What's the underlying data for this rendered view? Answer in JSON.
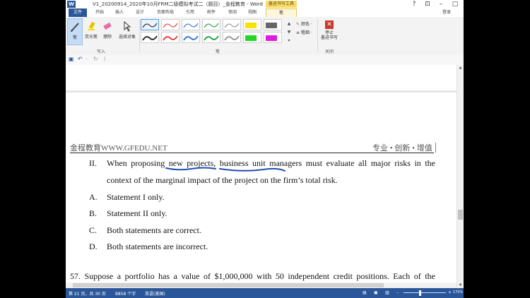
{
  "window": {
    "app_icon": "W",
    "title": "V1_20200914_2020年10月FRM二级模拟考试二（题目）_金程教育 - Word",
    "context_tab": "墨迹书写工具",
    "controls": [
      "?",
      "⊡",
      "–",
      "□"
    ],
    "sign_in": "登录"
  },
  "tabs": [
    "文件",
    "开始",
    "插入",
    "设计",
    "页面布局",
    "引用",
    "邮件",
    "审阅",
    "视图",
    "笔"
  ],
  "ribbon": {
    "write_group": {
      "label": "写入",
      "buttons": [
        {
          "label": "笔",
          "icon": "pen-icon"
        },
        {
          "label": "荧光笔",
          "icon": "highlighter-icon"
        },
        {
          "label": "擦除",
          "icon": "eraser-icon"
        },
        {
          "label": "选择对象",
          "icon": "select-arrow-icon"
        }
      ]
    },
    "pens_group": {
      "label": "笔",
      "color_label": "颜色 ·",
      "thickness_label": "粗细 ·",
      "swatch_colors": [
        "#333333",
        "#e04848",
        "#3b7dd8",
        "#2da44e",
        "#999999",
        "#f5e400",
        "#333333",
        "#e04848",
        "#3b7dd8",
        "#2da44e",
        "#999999",
        "#22d822"
      ],
      "swatch_colors_extra": [
        "#666666",
        "#e01be0"
      ]
    },
    "close_group": {
      "label": "关闭",
      "stop_label": "停止\n墨迹书写",
      "stop_icon": "close-x-icon"
    }
  },
  "quick_access": {
    "icons": [
      "save-icon",
      "undo-icon",
      "redo-icon",
      "customize-icon"
    ],
    "glyphs": [
      "▣",
      "↶",
      "·",
      "↻",
      "⁞"
    ]
  },
  "document": {
    "header_left": "金程教育WWW.GFEDU.NET",
    "header_right": "专业 • 创新 • 增值",
    "statement_numeral": "II.",
    "statement_line1": "When proposing new projects, business unit managers must evaluate all major risks in the",
    "statement_line2": "context of the marginal impact of the project on the firm’s total risk.",
    "options": [
      {
        "letter": "A.",
        "text": "Statement I only."
      },
      {
        "letter": "B.",
        "text": "Statement II only."
      },
      {
        "letter": "C.",
        "text": "Both statements are correct."
      },
      {
        "letter": "D.",
        "text": "Both statements are incorrect."
      }
    ],
    "next_question": "57.   Suppose a portfolio has a value of $1,000,000 with 50 independent credit positions. Each of the",
    "ink_color": "#1f4fb0"
  },
  "status_bar": {
    "page": "第 21 页，共 30 页",
    "words": "8858 个字",
    "language": "英语(美国)",
    "zoom": "170%",
    "zoom_minus": "–",
    "zoom_plus": "+"
  }
}
